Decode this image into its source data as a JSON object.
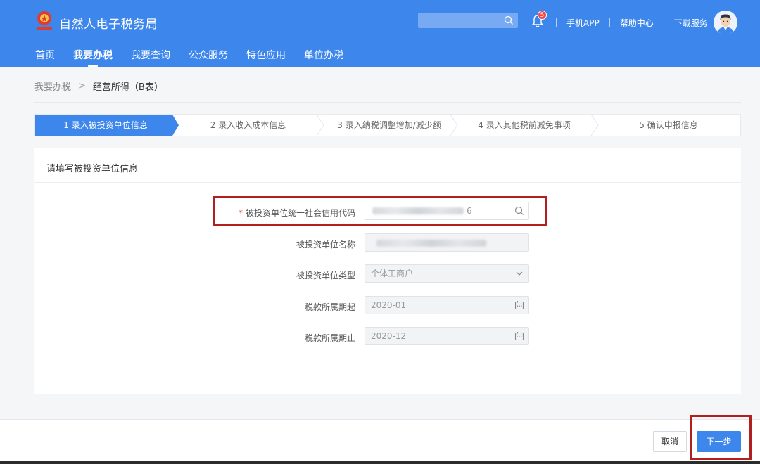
{
  "header": {
    "app_title": "自然人电子税务局",
    "notification_count": "5",
    "links": [
      "手机APP",
      "帮助中心",
      "下载服务"
    ]
  },
  "nav": {
    "items": [
      "首页",
      "我要办税",
      "我要查询",
      "公众服务",
      "特色应用",
      "单位办税"
    ],
    "active_index": 1
  },
  "breadcrumb": {
    "parent": "我要办税",
    "separator": ">",
    "current": "经营所得（B表）"
  },
  "steps": {
    "items": [
      "1 录入被投资单位信息",
      "2 录入收入成本信息",
      "3 录入纳税调整增加/减少额",
      "4 录入其他税前减免事项",
      "5 确认申报信息"
    ],
    "active_index": 0
  },
  "form": {
    "title": "请填写被投资单位信息",
    "credit_code_label": "被投资单位统一社会信用代码",
    "credit_code_required": "*",
    "credit_code_value_suffix": "6",
    "name_label": "被投资单位名称",
    "type_label": "被投资单位类型",
    "type_value": "个体工商户",
    "period_start_label": "税款所属期起",
    "period_start_value": "2020-01",
    "period_end_label": "税款所属期止",
    "period_end_value": "2020-12"
  },
  "footer": {
    "cancel_label": "取消",
    "next_label": "下一步"
  },
  "colors": {
    "brand": "#3d86ec",
    "highlight": "#b11f1f",
    "required": "#f04848"
  }
}
